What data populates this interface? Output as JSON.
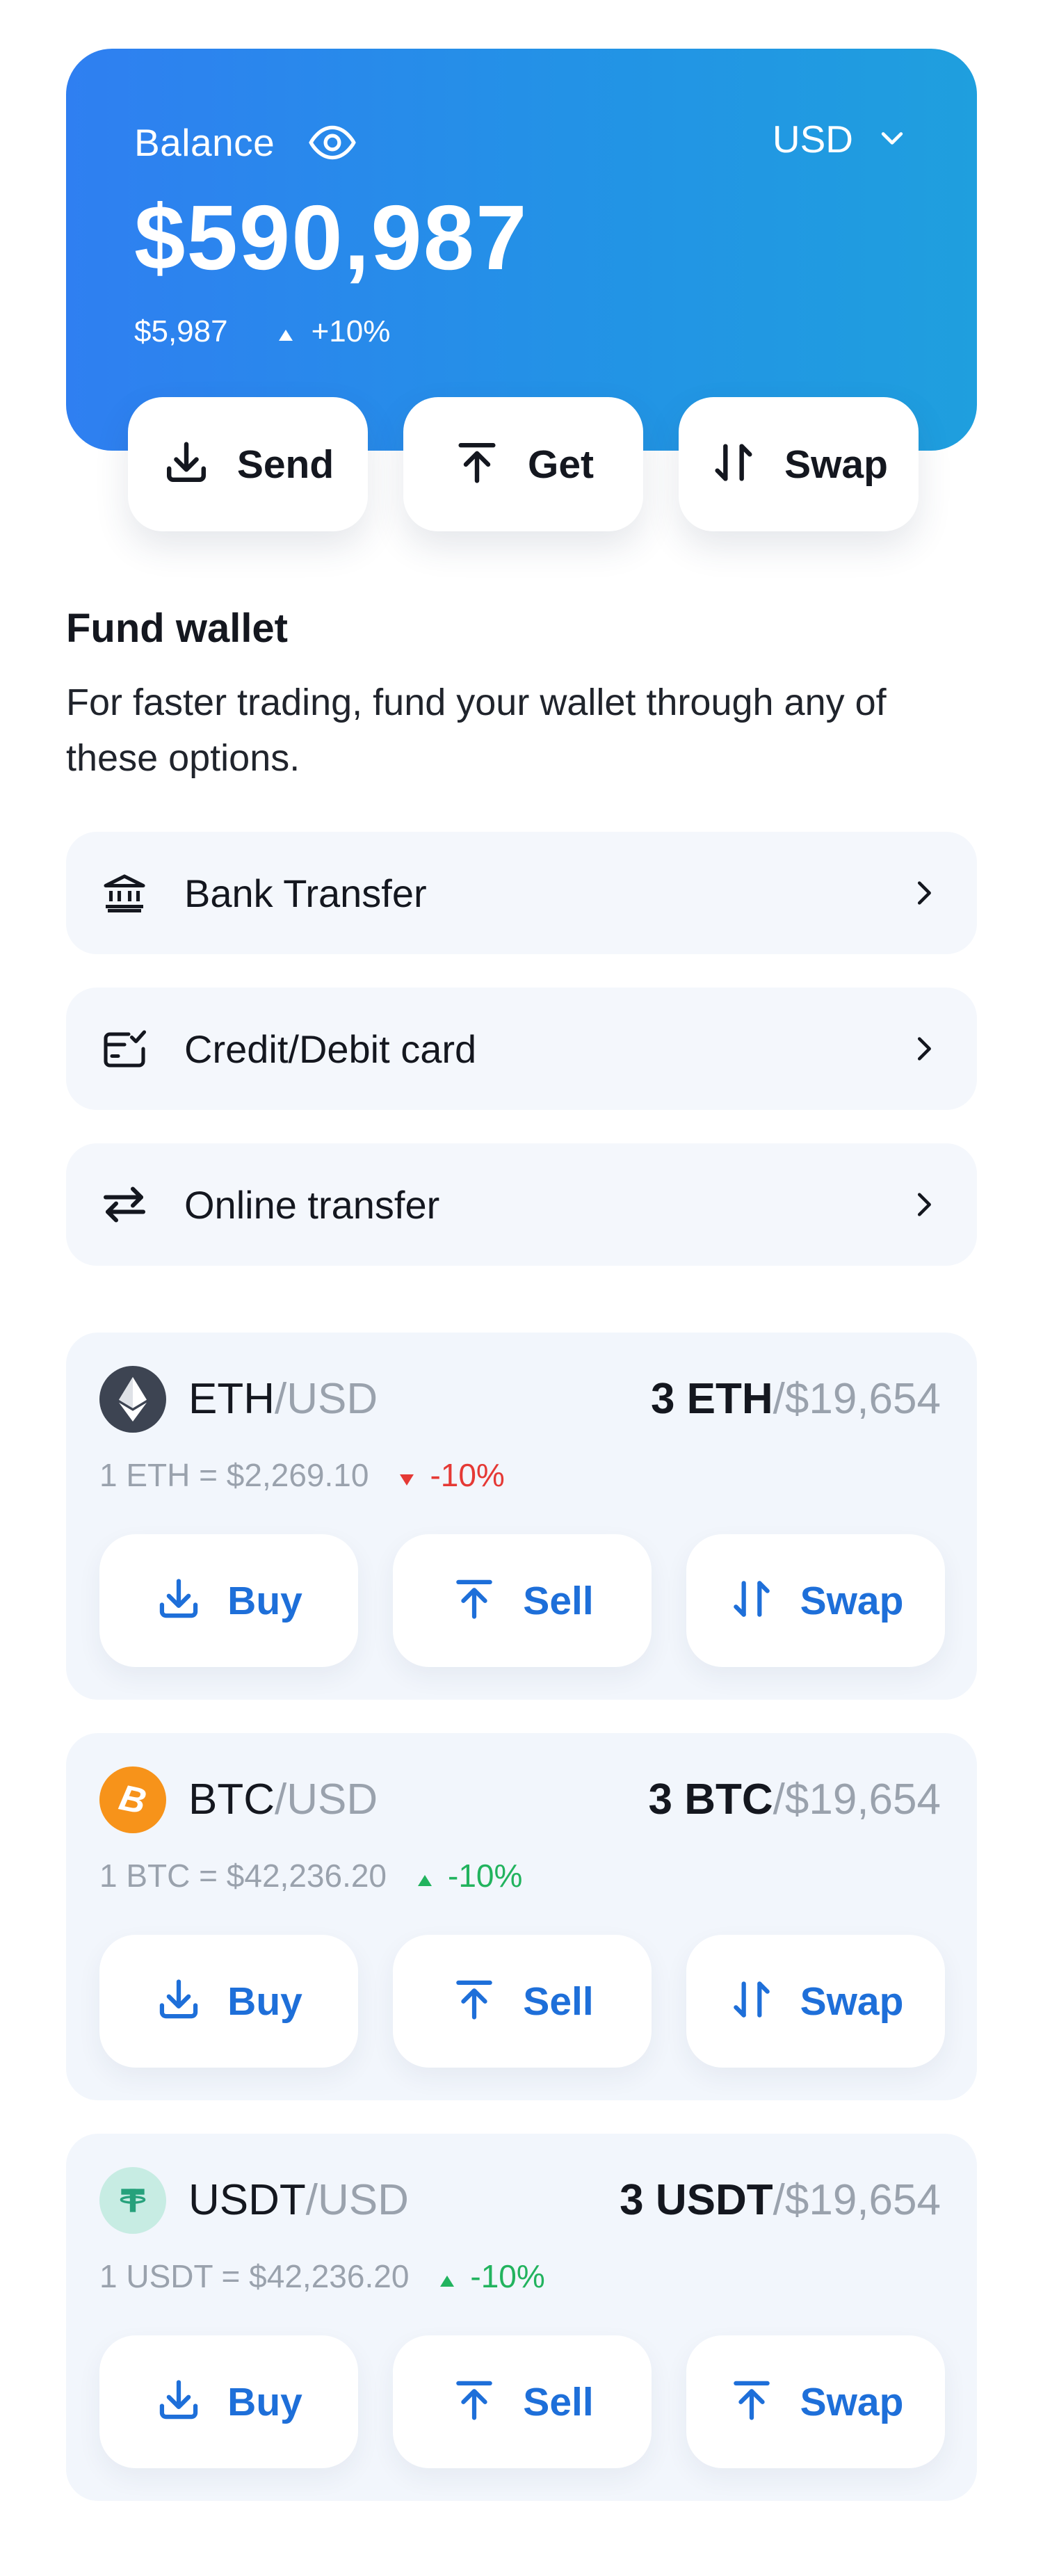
{
  "balance": {
    "label": "Balance",
    "currency": "USD",
    "amount": "$590,987",
    "sub_amount": "$5,987",
    "change": "+10%",
    "actions": [
      {
        "label": "Send",
        "icon": "download-icon"
      },
      {
        "label": "Get",
        "icon": "upload-icon"
      },
      {
        "label": "Swap",
        "icon": "swap-icon"
      }
    ]
  },
  "fund_wallet": {
    "title": "Fund wallet",
    "description": "For faster trading, fund your wallet through any of these options.",
    "options": [
      {
        "label": "Bank Transfer",
        "icon": "bank-icon"
      },
      {
        "label": "Credit/Debit card",
        "icon": "card-icon"
      },
      {
        "label": "Online transfer",
        "icon": "transfer-arrows-icon"
      }
    ]
  },
  "assets": [
    {
      "symbol": "ETH",
      "quote": "/USD",
      "holding": "3 ETH",
      "holding_value": "/$19,654",
      "rate": "1 ETH = $2,269.10",
      "change": "-10%",
      "change_direction": "down",
      "logo_icon": "ethereum-icon",
      "buttons": [
        {
          "label": "Buy",
          "icon": "download-icon"
        },
        {
          "label": "Sell",
          "icon": "upload-icon"
        },
        {
          "label": "Swap",
          "icon": "swap-icon"
        }
      ]
    },
    {
      "symbol": "BTC",
      "quote": "/USD",
      "holding": "3 BTC",
      "holding_value": "/$19,654",
      "rate": "1 BTC = $42,236.20",
      "change": "-10%",
      "change_direction": "up",
      "logo_icon": "bitcoin-icon",
      "buttons": [
        {
          "label": "Buy",
          "icon": "download-icon"
        },
        {
          "label": "Sell",
          "icon": "upload-icon"
        },
        {
          "label": "Swap",
          "icon": "swap-icon"
        }
      ]
    },
    {
      "symbol": "USDT",
      "quote": "/USD",
      "holding": "3 USDT",
      "holding_value": "/$19,654",
      "rate": "1 USDT = $42,236.20",
      "change": "-10%",
      "change_direction": "up",
      "logo_icon": "tether-icon",
      "buttons": [
        {
          "label": "Buy",
          "icon": "download-icon"
        },
        {
          "label": "Sell",
          "icon": "upload-icon"
        },
        {
          "label": "Swap",
          "icon": "upload-icon"
        }
      ]
    }
  ],
  "colors": {
    "gradient_start": "#2f7ff1",
    "gradient_end": "#1f9fde",
    "accent_blue": "#1e6fd9",
    "negative_red": "#e53935",
    "positive_green": "#22b35e",
    "muted_text": "#9aa2ad",
    "card_bg": "#f2f6fc",
    "eth_logo_bg": "#3d4452",
    "btc_logo_bg": "#f7931a",
    "usdt_logo_bg": "#c7ece3",
    "usdt_logo_fg": "#26a17b"
  }
}
